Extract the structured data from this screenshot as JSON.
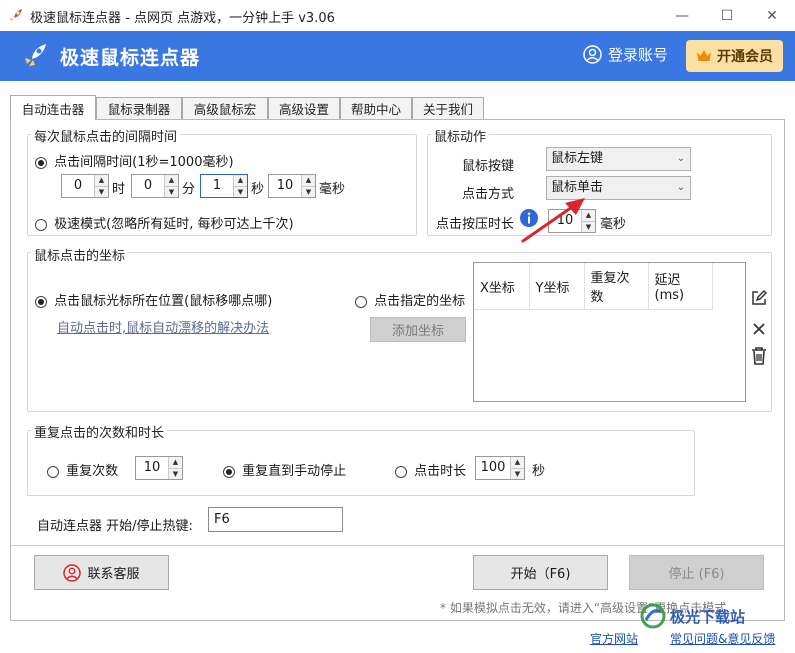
{
  "window": {
    "title": "极速鼠标连点器 - 点网页 点游戏，一分钟上手 v3.06",
    "minimize": "—",
    "maximize": "☐",
    "close": "✕"
  },
  "header": {
    "brand": "极速鼠标连点器",
    "login": "登录账号",
    "vip": "开通会员"
  },
  "tabs": [
    {
      "label": "自动连击器",
      "active": true
    },
    {
      "label": "鼠标录制器"
    },
    {
      "label": "高级鼠标宏"
    },
    {
      "label": "高级设置"
    },
    {
      "label": "帮助中心"
    },
    {
      "label": "关于我们"
    }
  ],
  "interval": {
    "title": "每次鼠标点击的间隔时间",
    "option1": "点击间隔时间(1秒=1000毫秒)",
    "hours": "0",
    "hours_unit": "时",
    "minutes": "0",
    "minutes_unit": "分",
    "seconds": "1",
    "seconds_unit": "秒",
    "ms": "10",
    "ms_unit": "毫秒",
    "option2": "极速模式(忽略所有延时, 每秒可达上千次)"
  },
  "action": {
    "title": "鼠标动作",
    "button_label": "鼠标按键",
    "button_value": "鼠标左键",
    "mode_label": "点击方式",
    "mode_value": "鼠标单击",
    "press_label": "点击按压时长",
    "press_value": "10",
    "press_unit": "毫秒"
  },
  "coords": {
    "title": "鼠标点击的坐标",
    "option1": "点击鼠标光标所在位置(鼠标移哪点哪)",
    "help_link": "自动点击时,鼠标自动漂移的解决办法",
    "option2": "点击指定的坐标",
    "add_button": "添加坐标",
    "columns": [
      "X坐标",
      "Y坐标",
      "重复次数",
      "延迟(ms)"
    ]
  },
  "repeat": {
    "title": "重复点击的次数和时长",
    "opt_count": "重复次数",
    "count_value": "10",
    "opt_until_stop": "重复直到手动停止",
    "opt_duration": "点击时长",
    "duration_value": "100",
    "duration_unit": "秒"
  },
  "hotkey": {
    "label": "自动连点器 开始/停止热键:",
    "value": "F6"
  },
  "footer": {
    "support": "联系客服",
    "start": "开始（F6)",
    "stop": "停止 (F6)",
    "note": "* 如果模拟点击无效，请进入“高级设置”更换点击模式",
    "site_link": "官方网站",
    "faq_link": "常见问题&意见反馈",
    "watermark": "极光下载站"
  },
  "colors": {
    "header": "#3b77e3",
    "vip_bg": "#fbe0a3",
    "arrow": "#d8262c"
  }
}
